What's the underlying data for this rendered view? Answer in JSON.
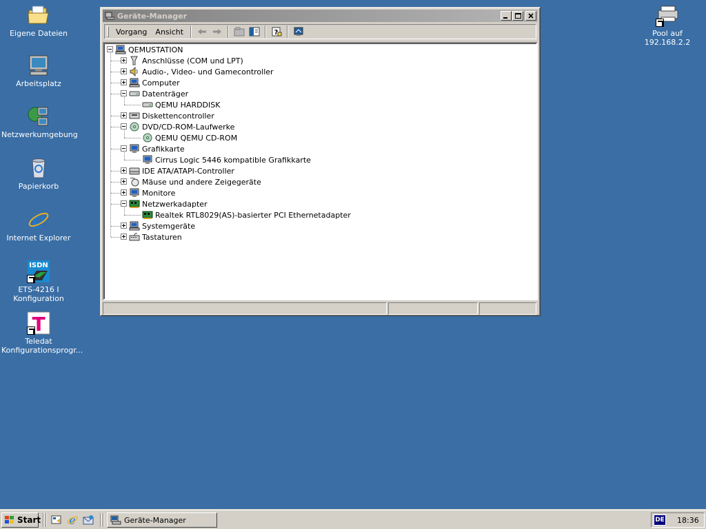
{
  "desktop": {
    "icons": [
      {
        "label": "Eigene Dateien"
      },
      {
        "label": "Arbeitsplatz"
      },
      {
        "label": "Netzwerkumgebung"
      },
      {
        "label": "Papierkorb"
      },
      {
        "label": "Internet Explorer"
      },
      {
        "label": "ETS-4216 I Konfiguration"
      },
      {
        "label": "Teledat Konfigurationsprogr..."
      },
      {
        "label": "Pool auf 192.168.2.2"
      }
    ],
    "isdn_text": "ISDN",
    "teledat_letter": "T"
  },
  "window": {
    "title": "Geräte-Manager",
    "menu": {
      "action": "Vorgang",
      "view": "Ansicht"
    },
    "tree": {
      "root": "QEMUSTATION",
      "items": [
        {
          "label": "Anschlüsse (COM und LPT)"
        },
        {
          "label": "Audio-, Video- und Gamecontroller"
        },
        {
          "label": "Computer"
        },
        {
          "label": "Datenträger",
          "children": [
            {
              "label": "QEMU HARDDISK"
            }
          ]
        },
        {
          "label": "Diskettencontroller"
        },
        {
          "label": "DVD/CD-ROM-Laufwerke",
          "children": [
            {
              "label": "QEMU QEMU CD-ROM"
            }
          ]
        },
        {
          "label": "Grafikkarte",
          "children": [
            {
              "label": "Cirrus Logic 5446 kompatible Grafikkarte"
            }
          ]
        },
        {
          "label": "IDE ATA/ATAPI-Controller"
        },
        {
          "label": "Mäuse und andere Zeigegeräte"
        },
        {
          "label": "Monitore"
        },
        {
          "label": "Netzwerkadapter",
          "children": [
            {
              "label": "Realtek RTL8029(AS)-basierter PCI Ethernetadapter"
            }
          ]
        },
        {
          "label": "Systemgeräte"
        },
        {
          "label": "Tastaturen"
        }
      ]
    }
  },
  "taskbar": {
    "start_label": "Start",
    "task_label": "Geräte-Manager",
    "lang": "DE",
    "clock": "18:36"
  }
}
